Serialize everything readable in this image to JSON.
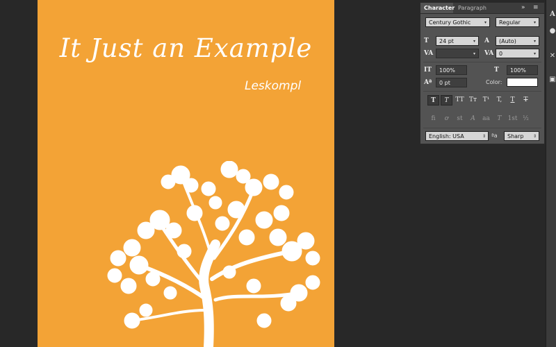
{
  "document": {
    "title": "It Just an Example",
    "author": "Leskompl",
    "background_color": "#f3a336",
    "text_color": "#ffffff"
  },
  "panel": {
    "tabs": [
      "Character",
      "Paragraph"
    ],
    "menu_icons": [
      "collapse-icon",
      "panel-menu-icon"
    ],
    "font_family": "Century Gothic",
    "font_style": "Regular",
    "font_size": "24 pt",
    "leading": "(Auto)",
    "kerning": "",
    "tracking": "0",
    "vertical_scale": "100%",
    "horizontal_scale": "100%",
    "baseline_shift": "0 pt",
    "color_label": "Color:",
    "color_value": "#ffffff",
    "style_buttons": [
      "T",
      "T",
      "TT",
      "Tт",
      "T¹",
      "T,",
      "T",
      "T"
    ],
    "opentype_buttons": [
      "fi",
      "ơ",
      "st",
      "A",
      "aa",
      "T",
      "1st",
      "½"
    ],
    "language": "English: USA",
    "aa_label": "ªa",
    "anti_alias": "Sharp"
  },
  "dock": {
    "icons": [
      "type-tool-icon",
      "dot-icon",
      "wrench-icon",
      "cube-icon"
    ]
  }
}
